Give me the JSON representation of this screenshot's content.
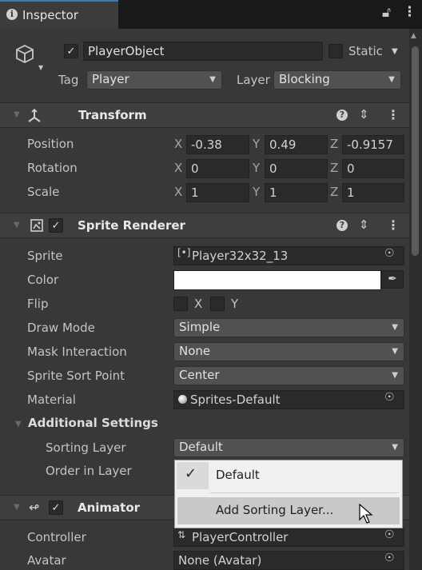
{
  "tab": {
    "title": "Inspector"
  },
  "object": {
    "name": "PlayerObject",
    "static_label": "Static",
    "tag_label": "Tag",
    "tag_value": "Player",
    "layer_label": "Layer",
    "layer_value": "Blocking"
  },
  "transform": {
    "title": "Transform",
    "rows": [
      {
        "label": "Position",
        "x": "-0.38",
        "y": "0.49",
        "z": "-0.9157"
      },
      {
        "label": "Rotation",
        "x": "0",
        "y": "0",
        "z": "0"
      },
      {
        "label": "Scale",
        "x": "1",
        "y": "1",
        "z": "1"
      }
    ],
    "axes": {
      "x": "X",
      "y": "Y",
      "z": "Z"
    }
  },
  "sprite_renderer": {
    "title": "Sprite Renderer",
    "sprite_label": "Sprite",
    "sprite_value": "Player32x32_13",
    "color_label": "Color",
    "color_value": "#ffffff",
    "flip_label": "Flip",
    "flip_x": "X",
    "flip_y": "Y",
    "draw_mode_label": "Draw Mode",
    "draw_mode_value": "Simple",
    "mask_label": "Mask Interaction",
    "mask_value": "None",
    "sort_point_label": "Sprite Sort Point",
    "sort_point_value": "Center",
    "material_label": "Material",
    "material_value": "Sprites-Default",
    "additional_label": "Additional Settings",
    "sorting_layer_label": "Sorting Layer",
    "sorting_layer_value": "Default",
    "order_label": "Order in Layer"
  },
  "popup": {
    "items": [
      {
        "label": "Default",
        "checked": true
      },
      {
        "label": "Add Sorting Layer...",
        "checked": false
      }
    ]
  },
  "animator": {
    "title": "Animator",
    "controller_label": "Controller",
    "controller_value": "PlayerController",
    "avatar_label": "Avatar",
    "avatar_value": "None (Avatar)"
  },
  "colors": {
    "accent": "#3a79bb",
    "background": "#383838",
    "field": "#2a2a2a",
    "dropdown": "#515151"
  }
}
